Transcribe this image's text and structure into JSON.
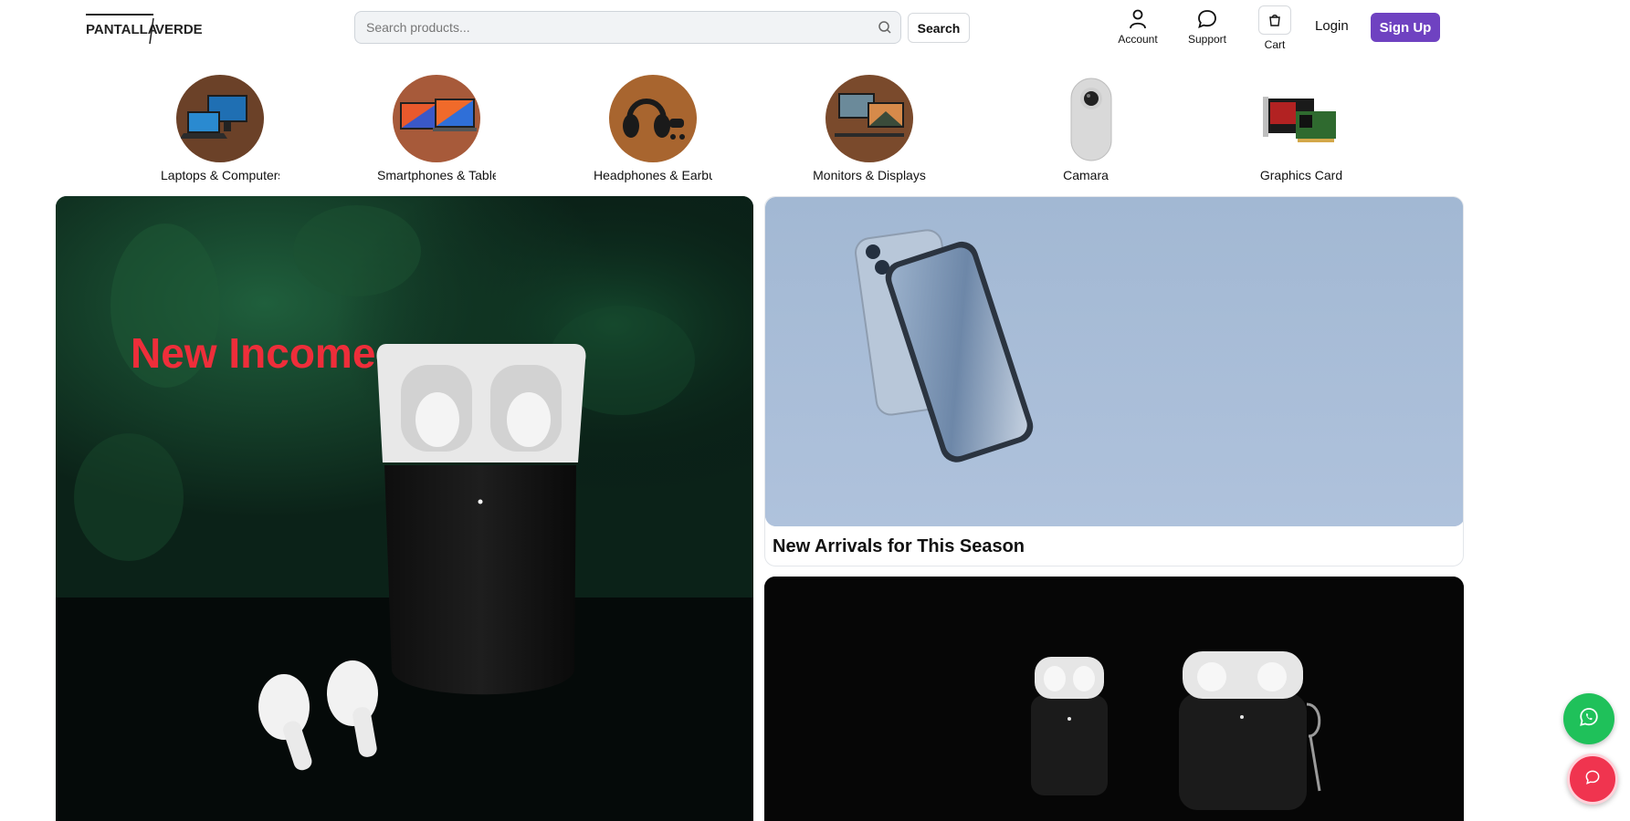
{
  "brand": {
    "logo_text_left": "PANTALLA",
    "logo_text_right": "VERDE"
  },
  "search": {
    "placeholder": "Search products...",
    "value": "",
    "button_label": "Search"
  },
  "nav": {
    "account_label": "Account",
    "support_label": "Support",
    "cart_label": "Cart",
    "login_label": "Login",
    "signup_label": "Sign Up"
  },
  "categories": [
    {
      "label": "Laptops & Computers",
      "image": "laptops-image"
    },
    {
      "label": "Smartphones & Tablets",
      "image": "smartphones-image"
    },
    {
      "label": "Headphones & Earbuds",
      "image": "headphones-image"
    },
    {
      "label": "Monitors & Displays",
      "image": "monitors-image"
    },
    {
      "label": "Camara",
      "image": "camera-image"
    },
    {
      "label": "Graphics Card",
      "image": "graphics-card-image"
    }
  ],
  "hero": {
    "title": "New Income",
    "image": "airpods-hero-image"
  },
  "featured": [
    {
      "caption": "New Arrivals for This Season",
      "image": "iphone-image"
    },
    {
      "caption": "",
      "image": "airpods-cases-image"
    }
  ],
  "floating": {
    "whatsapp_icon": "whatsapp-icon",
    "chat_icon": "chat-icon"
  },
  "colors": {
    "accent": "#6f42c1",
    "hero_title": "#ee2e3a",
    "whatsapp": "#1fc15a",
    "chat": "#f0344f"
  }
}
